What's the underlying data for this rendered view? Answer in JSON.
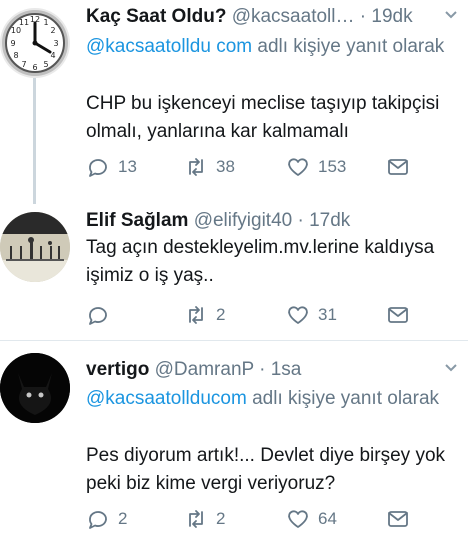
{
  "tweets": [
    {
      "name": "Kaç Saat Oldu?",
      "handle": "@kacsaatoll…",
      "time": "19dk",
      "reply_prefix": "",
      "reply_mention": "@kacsaatolldu com",
      "reply_suffix": " adlı kişiye yanıt olarak",
      "body": "CHP bu işkenceyi meclise taşıyıp takipçisi olmalı, yanlarına kar kalmamalı",
      "replies": "13",
      "retweets": "38",
      "likes": "153"
    },
    {
      "name": "Elif Sağlam",
      "handle": "@elifyigit40",
      "time": "17dk",
      "body": "Tag açın destekleyelim.mv.lerine kaldıysa işimiz o iş yaş..",
      "replies": "",
      "retweets": "2",
      "likes": "31"
    },
    {
      "name": "vertigo",
      "handle": "@DamranP",
      "time": "1sa",
      "reply_mention": "@kacsaatollducom",
      "reply_suffix": " adlı kişiye yanıt olarak",
      "body": "Pes diyorum artık!...  Devlet diye birşey yok peki biz kime vergi veriyoruz?",
      "replies": "2",
      "retweets": "2",
      "likes": "64"
    }
  ],
  "separator": "·",
  "colors": {
    "accent": "#1b95e0",
    "muted": "#657786",
    "text": "#14171a",
    "divider": "#e1e8ed",
    "thread": "#ccd6dd"
  },
  "icons": [
    "clock-avatar-icon",
    "reply-icon",
    "retweet-icon",
    "like-icon",
    "dm-icon",
    "chevron-down-icon"
  ]
}
